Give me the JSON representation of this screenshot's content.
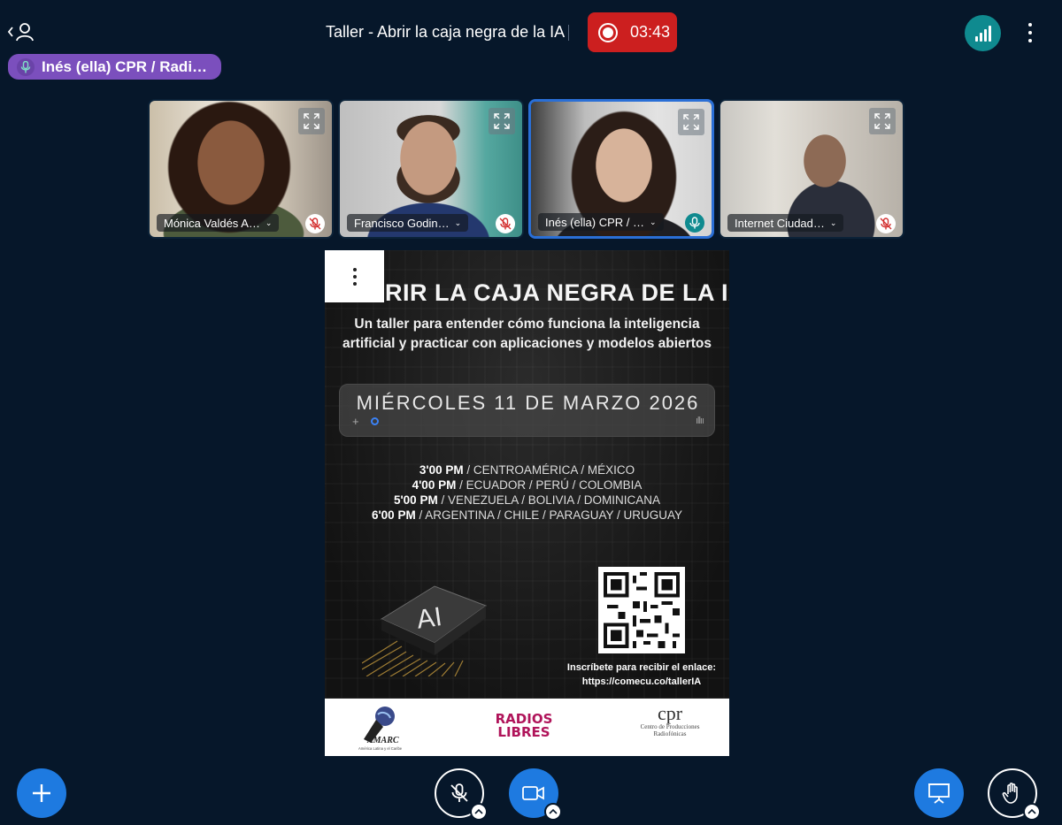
{
  "header": {
    "meeting_title": "Taller - Abrir la caja negra de la IA",
    "recording_time": "03:43",
    "talking_indicator": "Inés (ella) CPR / Radi…"
  },
  "participants": [
    {
      "name": "Mónica Valdés A…",
      "muted": true
    },
    {
      "name": "Francisco Godin…",
      "muted": true
    },
    {
      "name": "Inés (ella) CPR / …",
      "muted": false
    },
    {
      "name": "Internet Ciudad…",
      "muted": true
    }
  ],
  "slide": {
    "title_visible": "RIR LA CAJA NEGRA DE LA IA",
    "subtitle_line1": "Un taller para entender cómo funciona la inteligencia",
    "subtitle_line2": "artificial y practicar con aplicaciones y modelos abiertos",
    "date": "MIÉRCOLES 11 DE MARZO 2026",
    "schedule": [
      {
        "time": "3'00 PM",
        "places": " / CENTROAMÉRICA / MÉXICO"
      },
      {
        "time": "4'00 PM",
        "places": " / ECUADOR / PERÚ / COLOMBIA"
      },
      {
        "time": "5'00 PM",
        "places": " / VENEZUELA / BOLIVIA / DOMINICANA"
      },
      {
        "time": "6'00 PM",
        "places": " / ARGENTINA / CHILE / PARAGUAY / URUGUAY"
      }
    ],
    "chip_label": "AI",
    "cta_line1": "Inscríbete para recibir el enlace:",
    "cta_line2": "https://comecu.co/tallerIA",
    "logos": {
      "amarc": "AMARC",
      "amarc_sub": "América Latina y el Caribe",
      "radios_line1": "RADIOS",
      "radios_line2": "LIBRES",
      "cpr": "cpr",
      "cpr_sub": "Centro de Producciones Radiofónicas"
    }
  },
  "colors": {
    "background": "#06172a",
    "record": "#cc1f1f",
    "talking": "#7b4fbd",
    "accent": "#1e7ae0",
    "connection": "#0f8a8f"
  },
  "icons": {
    "user_list": "user-list-icon",
    "connection": "signal-bars-icon",
    "options": "more-vertical-icon",
    "fullscreen": "fullscreen-icon",
    "muted_mic": "mic-off-icon",
    "active_mic": "mic-icon",
    "actions": "plus-icon",
    "audio": "mic-off-icon",
    "video": "camera-icon",
    "present": "presentation-icon",
    "raise_hand": "hand-icon"
  }
}
